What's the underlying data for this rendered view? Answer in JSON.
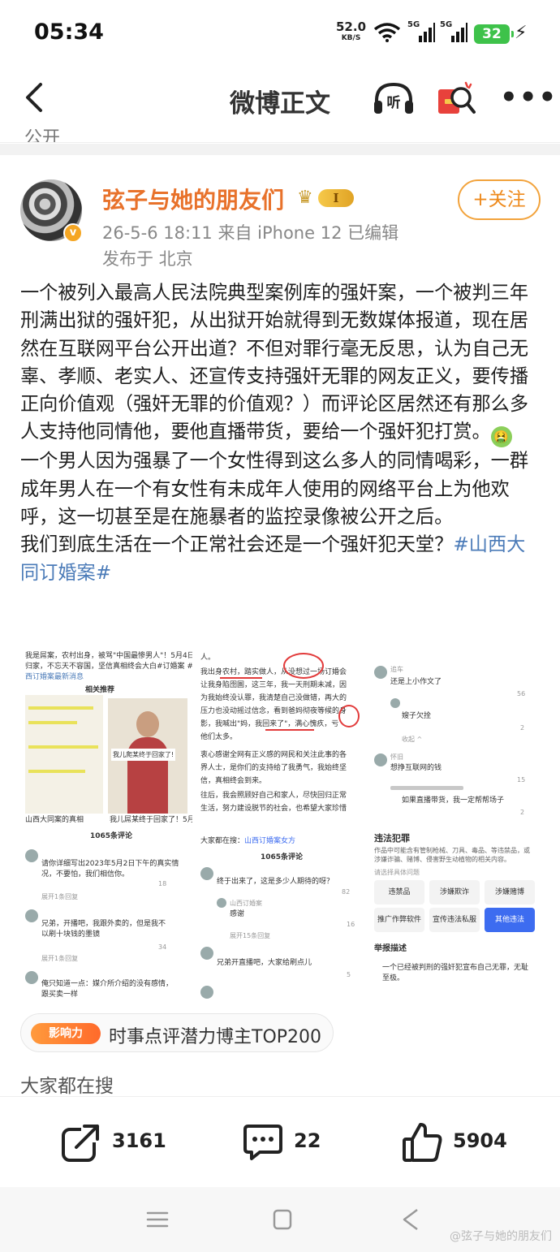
{
  "status": {
    "time": "05:34",
    "net_speed": "52.0",
    "net_unit": "KB/S",
    "sim1": "5G",
    "sim2": "5G",
    "battery": "32"
  },
  "nav": {
    "title": "微博正文",
    "listen_label": "听"
  },
  "prev_stub": "公开",
  "post": {
    "username": "弦子与她的朋友们",
    "vip_level": "I",
    "verified_mark": "v",
    "meta_line1": "26-5-6 18:11  来自 iPhone 12  已编辑",
    "meta_line2": "发布于 北京",
    "follow_label": "+关注",
    "para1": "一个被列入最高人民法院典型案例库的强奸案，一个被判三年刑满出狱的强奸犯，从出狱开始就得到无数媒体报道，现在居然在互联网平台公开出道？不但对罪行毫无反思，认为自己无辜、孝顺、老实人、还宣传支持强奸无罪的网友正义，要传播正向价值观（强奸无罪的价值观？）而评论区居然还有那么多人支持他同情他，要他直播带货，要给一个强奸犯打赏。",
    "emoji": "🤮",
    "para2": "一个男人因为强暴了一个女性得到这么多人的同情喝彩，一群成年男人在一个有女性有未成年人使用的网络平台上为他欢呼，这一切甚至是在施暴者的监控录像被公开之后。",
    "para3_lead": "我们到底生活在一个正常社会还是一个强奸犯天堂？",
    "hashtag": "#山西大同订婚案#"
  },
  "images": {
    "p1": {
      "line1": "我是屌案，农村出身，被骂\"中国最惨男人\"！5月4日",
      "line2": "归家，不忘天不容国，坚信真相终会大白#订婚案 #山",
      "line3": "西订婚案最新消息",
      "section": "相关推荐",
      "photo_caption": "我儿爬某终于回家了!",
      "foot_left": "山西大同案的真相",
      "foot_right": "我儿屌某终于回家了！5月4"
    },
    "p2": {
      "lines": [
        "人。",
        "我出身农村，踏实做人，从没想过一场订婚会",
        "让我身陷囹圄，这三年，我一天刑期未减，因",
        "为我始终没认罪，我清楚自己没做错，再大的",
        "压力也没动摇过信念，看到爸妈彻夜等候的身",
        "影，我喊出\"妈，我回来了\"，满心愧疚，亏",
        "他们太多。",
        "衷心感谢全网有正义感的网民和关注此事的各",
        "界人士，是你们的支持给了我勇气，我始终坚",
        "信，真相终会到来。",
        "往后，我会照顾好自己和家人，尽快回归正常",
        "生活，努力建设脱节的社会，也希望大家珍惜"
      ]
    },
    "p3": {
      "c1_name": "追车",
      "c1_text": "还是上小作文了",
      "c1_likes": "56",
      "c2_text": "嫂子欠拴",
      "c2_likes": "2",
      "more1": "收起 ^",
      "c3_name": "怀旧",
      "c3_text": "想挣互联网的钱",
      "c3_likes": "15",
      "c4_text": "如果直播带货，我一定帮帮场子",
      "c4_likes": "2"
    },
    "p4": {
      "header": "1065条评论",
      "c1_text": "请你详细写出2023年5月2日下午的真实情况，不要怕，我们相信你。",
      "c1_likes": "18",
      "expand1": "展开1条回复",
      "c2_text": "兄弟，开播吧，我跟外卖的，但是我不以刷十块钱的墨镜",
      "c2_likes": "34",
      "expand2": "展开1条回复",
      "c3_text": "俺只知道一点：媒介所介绍的没有感情，跟买卖一样"
    },
    "p5": {
      "search_label": "大家都在搜：",
      "search_term": "山西订婚案女方",
      "header": "1065条评论",
      "c1_text": "终于出来了，这是多少人期待的呀？",
      "c1_likes": "82",
      "c2_name": "山西订婚案",
      "c2_text": "感谢",
      "c2_likes": "16",
      "expand": "展开15条回复",
      "c3_text": "兄弟开直播吧，大家给刷点儿",
      "c3_likes": "5"
    },
    "p6": {
      "title": "违法犯罪",
      "desc": "作品中可能含有管制枪械、刀具、毒品、等违禁品，或涉嫌诈骗、赌博、侵害野生动植物的相关内容。",
      "sub": "请选择具体问题",
      "opts": [
        "违禁品",
        "涉嫌欺诈",
        "涉嫌赌博",
        "推广作弊软件",
        "宣传违法私服",
        "其他违法"
      ],
      "report_title": "举报描述",
      "report_text": "一个已经被判刑的强奸犯宣布自己无罪，无耻至极。"
    }
  },
  "badge": {
    "pill": "影响力",
    "text": "时事点评潜力博主TOP200"
  },
  "searching": "大家都在搜",
  "actions": {
    "repost": "3161",
    "comment": "22",
    "like": "5904"
  },
  "watermark": "@弦子与她的朋友们"
}
